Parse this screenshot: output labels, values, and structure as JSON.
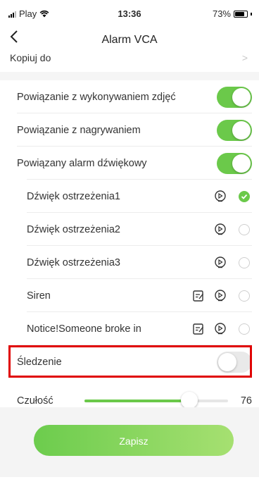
{
  "status_bar": {
    "carrier": "Play",
    "time": "13:36",
    "battery": "73%"
  },
  "nav": {
    "title": "Alarm VCA"
  },
  "kopiuj": {
    "label": "Kopiuj do"
  },
  "toggles": [
    {
      "label": "Powiązanie z wykonywaniem zdjęć",
      "on": true
    },
    {
      "label": "Powiązanie z nagrywaniem",
      "on": true
    },
    {
      "label": "Powiązany alarm dźwiękowy",
      "on": true
    }
  ],
  "sounds": [
    {
      "label": "Dźwięk ostrzeżenia1",
      "editable": false,
      "selected": true
    },
    {
      "label": "Dźwięk ostrzeżenia2",
      "editable": false,
      "selected": false
    },
    {
      "label": "Dźwięk ostrzeżenia3",
      "editable": false,
      "selected": false
    },
    {
      "label": "Siren",
      "editable": true,
      "selected": false
    },
    {
      "label": "Notice!Someone broke in",
      "editable": true,
      "selected": false
    }
  ],
  "tracking": {
    "label": "Śledzenie",
    "on": false
  },
  "sensitivity": {
    "label": "Czułość",
    "value": "76",
    "fraction": 0.73
  },
  "save_button": {
    "label": "Zapisz"
  },
  "colors": {
    "accent": "#6bc94a",
    "highlight": "#e00000"
  }
}
